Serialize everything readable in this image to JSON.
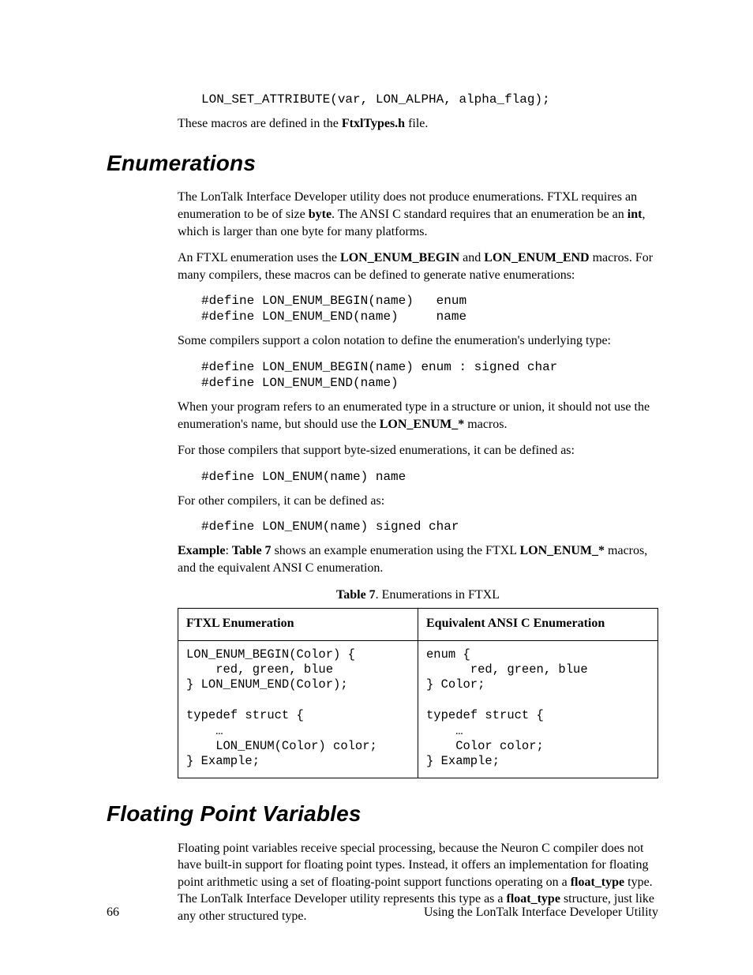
{
  "top_code": "LON_SET_ATTRIBUTE(var, LON_ALPHA, alpha_flag);",
  "top_para_a": "These macros are defined in the ",
  "top_para_b": "FtxlTypes.h",
  "top_para_c": " file.",
  "sec1_title": "Enumerations",
  "sec1_p1_a": "The LonTalk Interface Developer utility does not produce enumerations.  FTXL requires an enumeration to be of size ",
  "sec1_p1_b": "byte",
  "sec1_p1_c": ".  The ANSI C standard requires that an enumeration be an ",
  "sec1_p1_d": "int",
  "sec1_p1_e": ", which is larger than one byte for many platforms.",
  "sec1_p2_a": "An FTXL enumeration uses the ",
  "sec1_p2_b": "LON_ENUM_BEGIN",
  "sec1_p2_c": " and ",
  "sec1_p2_d": "LON_ENUM_END",
  "sec1_p2_e": " macros.  For many compilers, these macros can be defined to generate native enumerations:",
  "sec1_code1": "#define LON_ENUM_BEGIN(name)   enum\n#define LON_ENUM_END(name)     name",
  "sec1_p3": "Some compilers support a colon notation to define the enumeration's underlying type:",
  "sec1_code2": "#define LON_ENUM_BEGIN(name) enum : signed char\n#define LON_ENUM_END(name)",
  "sec1_p4_a": "When your program refers to an enumerated type in a structure or union, it should not use the enumeration's name, but should use the ",
  "sec1_p4_b": "LON_ENUM_*",
  "sec1_p4_c": " macros.",
  "sec1_p5": "For those compilers that support byte-sized enumerations, it can be defined as:",
  "sec1_code3": "#define LON_ENUM(name) name",
  "sec1_p6": "For other compilers, it can be defined as:",
  "sec1_code4": "#define LON_ENUM(name) signed char",
  "sec1_p7_a": "Example",
  "sec1_p7_b": ":  ",
  "sec1_p7_c": "Table 7",
  "sec1_p7_d": " shows an example enumeration using the FTXL ",
  "sec1_p7_e": "LON_ENUM_*",
  "sec1_p7_f": " macros, and the equivalent ANSI C enumeration.",
  "table_caption_a": "Table 7",
  "table_caption_b": ". Enumerations in FTXL",
  "th1": "FTXL Enumeration",
  "th2": "Equivalent ANSI C Enumeration",
  "td1": "LON_ENUM_BEGIN(Color) { \n    red, green, blue  \n} LON_ENUM_END(Color); \n \ntypedef struct { \n    … \n    LON_ENUM(Color) color; \n} Example;",
  "td2": "enum { \n      red, green, blue \n} Color; \n \ntypedef struct { \n    … \n    Color color; \n} Example;",
  "sec2_title": "Floating Point Variables",
  "sec2_p1_a": "Floating point variables receive special processing, because the Neuron C compiler does not have built-in support for floating point types.  Instead, it offers an implementation for floating point arithmetic using a set of floating-point support functions operating on a ",
  "sec2_p1_b": "float_type",
  "sec2_p1_c": " type.  The LonTalk Interface Developer utility represents this type as a ",
  "sec2_p1_d": "float_type",
  "sec2_p1_e": " structure, just like any other structured type.",
  "footer_page": "66",
  "footer_title": "Using the LonTalk Interface Developer Utility"
}
